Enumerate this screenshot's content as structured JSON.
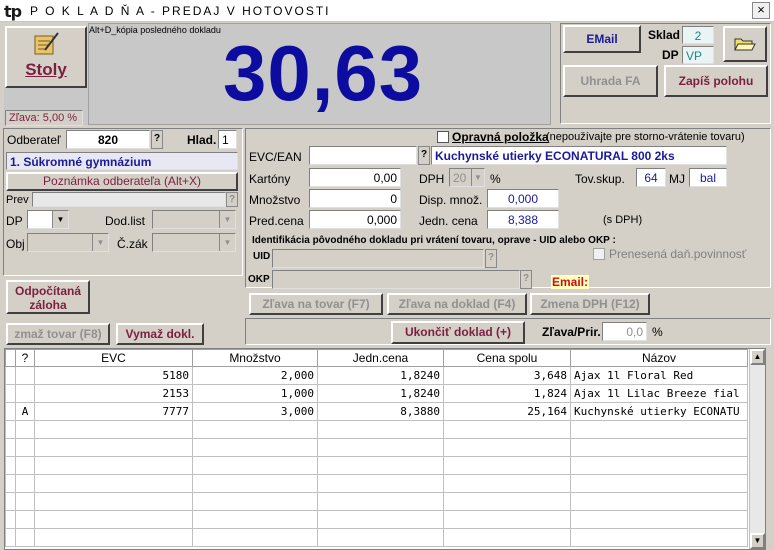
{
  "window": {
    "title": "P O K L A D Ň A  -  PREDAJ V HOTOVOSTI",
    "close": "×"
  },
  "top": {
    "hint": "Alt+D_kópia posledného dokladu",
    "total": "30,63",
    "discount": "Zľava: 5,00 %",
    "stoly_label": "Stoly",
    "email_btn": "EMail",
    "sklad_label": "Sklad",
    "sklad_value": "2",
    "dp_label": "DP",
    "dp_value": "VP",
    "uhrada_btn": "Uhrada FA",
    "zapis_btn": "Zapíš polohu"
  },
  "customer": {
    "odberatel_label": "Odberateľ",
    "odberatel_value": "820",
    "hlad_label": "Hlad.",
    "hlad_value": "1",
    "name": "1. Súkromné gymnázium",
    "note_btn": "Poznámka odberateľa (Alt+X)",
    "prev_label": "Prev",
    "dp_label": "DP",
    "dodlist_label": "Dod.list",
    "obj_label": "Obj",
    "czak_label": "Č.zák"
  },
  "item": {
    "opravna_label": "Opravná položka",
    "opravna_note": " (nepoužívajte pre storno-vrátenie tovaru)",
    "evc_label": "EVC/EAN",
    "product_name": "Kuchynské utierky ECONATURAL 800 2ks",
    "kartony_label": "Kartóny",
    "kartony_value": "0,00",
    "dph_label": "DPH",
    "dph_value": "20",
    "pct": "%",
    "tovskup_label": "Tov.skup.",
    "tovskup_value": "64",
    "mj_label": "MJ",
    "mj_value": "bal",
    "mnozstvo_label": "Množstvo",
    "mnozstvo_value": "0",
    "disp_label": "Disp. množ.",
    "disp_value": "0,000",
    "predcena_label": "Pred.cena",
    "predcena_value": "0,000",
    "jedn_label": "Jedn. cena",
    "jedn_value": "8,388",
    "sdph": "(s DPH)",
    "ident_label": "Identifikácia pôvodného dokladu pri vrátení tovaru, oprave - UID alebo OKP :",
    "uid_label": "UID",
    "okp_label": "OKP",
    "prenesena_label": "Prenesená daň.povinnosť",
    "email_label": "Email:"
  },
  "actions": {
    "odpocitana": "Odpočítaná záloha",
    "zmaz_tovar": "zmaž tovar (F8)",
    "vymaz_dokl": "Vymaž dokl.",
    "zlava_tovar": "Zľava na tovar (F7)",
    "zlava_doklad": "Zľava na doklad (F4)",
    "zmena_dph": "Zmena DPH (F12)",
    "ukoncit": "Ukončiť doklad (+)",
    "zlava_prir_label": "Zľava/Prir.",
    "zlava_prir_value": "0,0",
    "zlava_prir_pct": "%"
  },
  "table": {
    "headers": [
      "?",
      "EVC",
      "Množstvo",
      "Jedn.cena",
      "Cena spolu",
      "Názov"
    ],
    "rows": [
      [
        "",
        "5180",
        "2,000",
        "1,8240",
        "3,648",
        "Ajax 1l Floral Red"
      ],
      [
        "",
        "2153",
        "1,000",
        "1,8240",
        "1,824",
        "Ajax 1l Lilac Breeze fial"
      ],
      [
        "A",
        "7777",
        "3,000",
        "8,3880",
        "25,164",
        "Kuchynské utierky ECONATU"
      ]
    ]
  }
}
